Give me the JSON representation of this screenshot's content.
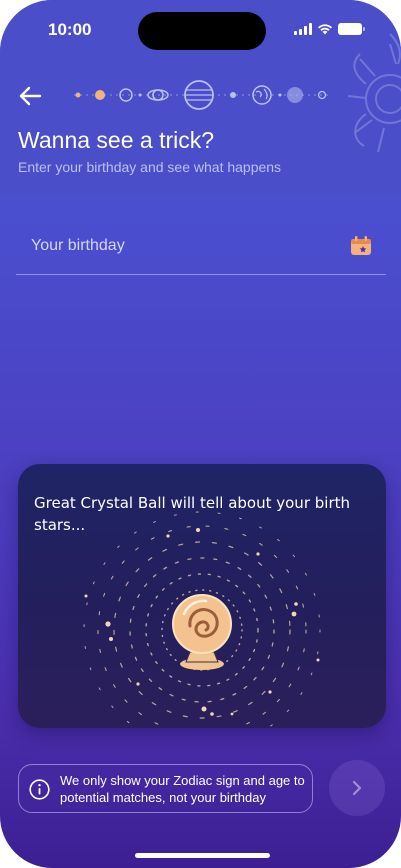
{
  "status_bar": {
    "time": "10:00"
  },
  "header": {
    "title": "Wanna see a trick?",
    "subtitle": "Enter your birthday and see what happens",
    "progress_steps": 10,
    "progress_current": 2
  },
  "birthday": {
    "placeholder": "Your birthday"
  },
  "crystal_card": {
    "text": "Great Crystal Ball will tell about your birth stars..."
  },
  "privacy_note": {
    "text": "We  only show your Zodiac sign and age to potential matches, not your birthday"
  },
  "colors": {
    "accent": "#f6b27c",
    "header_bg": "#4a4ec9",
    "card_bg": "#1f2466",
    "planet": "#b9c0f2"
  },
  "icons": {
    "back": "arrow-left-icon",
    "calendar": "calendar-icon",
    "info": "info-icon",
    "next": "chevron-right-icon"
  }
}
